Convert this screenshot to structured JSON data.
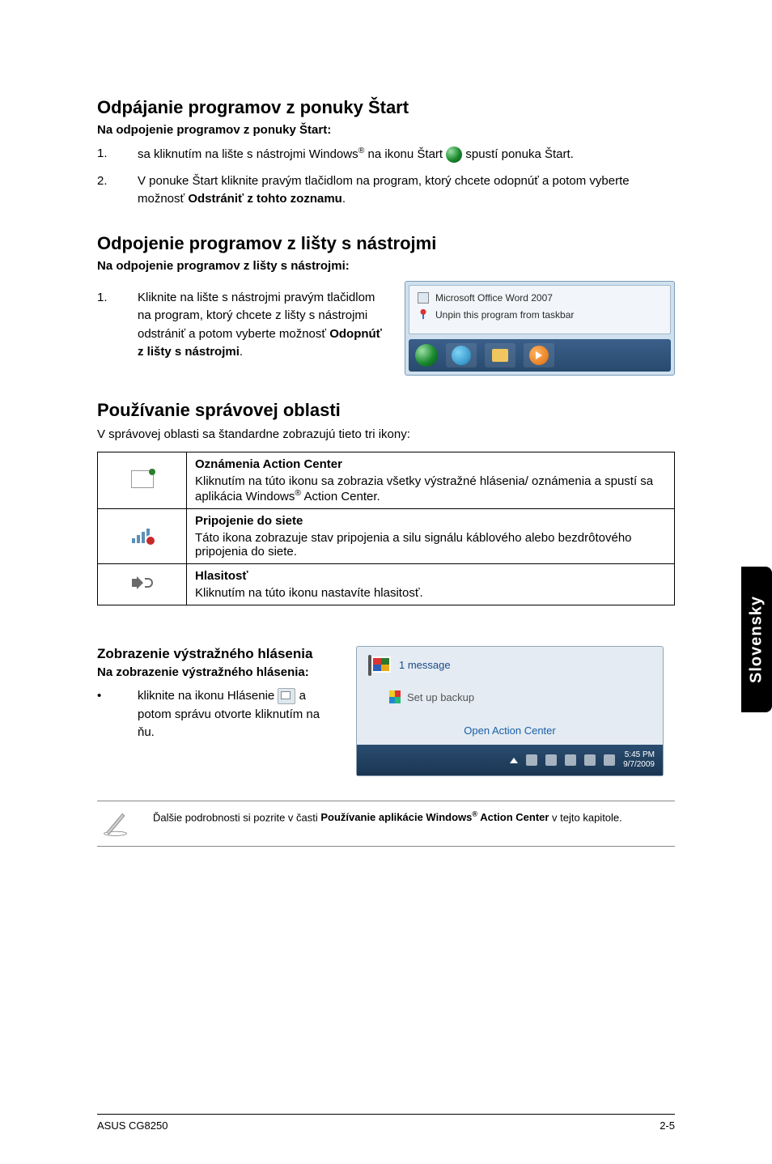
{
  "section1": {
    "title": "Odpájanie programov z ponuky Štart",
    "subhead": "Na odpojenie programov z ponuky Štart:",
    "step1_a": "sa kliknutím na lište s nástrojmi Windows",
    "step1_b": " na ikonu Štart ",
    "step1_c": " spustí ponuka Štart.",
    "step2_a": "V ponuke Štart kliknite pravým tlačidlom na program, ktorý chcete odopnúť a potom vyberte možnosť ",
    "step2_b": "Odstrániť z tohto zoznamu",
    "step2_c": "."
  },
  "section2": {
    "title": "Odpojenie programov z lišty s nástrojmi",
    "subhead": "Na odpojenie programov z lišty s nástrojmi:",
    "step1_a": "Kliknite na lište s nástrojmi pravým tlačidlom na program, ktorý chcete z lišty s nástrojmi odstrániť a potom vyberte možnosť ",
    "step1_b": "Odopnúť z lišty s nástrojmi",
    "step1_c": "."
  },
  "callout": {
    "line1": "Microsoft Office Word 2007",
    "line2": "Unpin this program from taskbar"
  },
  "section3": {
    "title": "Používanie správovej oblasti",
    "intro": "V správovej oblasti sa štandardne zobrazujú tieto tri ikony:"
  },
  "table": {
    "row1_title": "Oznámenia Action Center",
    "row1_body_a": "Kliknutím na túto ikonu sa zobrazia všetky výstražné hlásenia/ oznámenia a spustí sa aplikácia Windows",
    "row1_body_b": " Action Center.",
    "row2_title": "Pripojenie do siete",
    "row2_body": "Táto ikona zobrazuje stav pripojenia a silu signálu káblového alebo bezdrôtového pripojenia do siete.",
    "row3_title": "Hlasitosť",
    "row3_body": "Kliknutím na túto ikonu nastavíte hlasitosť."
  },
  "section4": {
    "title": "Zobrazenie výstražného hlásenia",
    "subhead": "Na zobrazenie výstražného hlásenia:",
    "bullet_a": "kliknite na ikonu Hlásenie ",
    "bullet_b": " a potom správu otvorte kliknutím na ňu."
  },
  "popup": {
    "messages": "1 message",
    "backup": "Set up backup",
    "action": "Open Action Center",
    "time": "5:45 PM",
    "date": "9/7/2009"
  },
  "note": {
    "text_a": "Ďalšie podrobnosti si pozrite v časti ",
    "text_b": "Používanie aplikácie Windows",
    "text_c": " Action Center",
    "text_d": " v tejto kapitole."
  },
  "sidetab": "Slovensky",
  "footer": {
    "left": "ASUS CG8250",
    "right": "2-5"
  },
  "sup": "®"
}
